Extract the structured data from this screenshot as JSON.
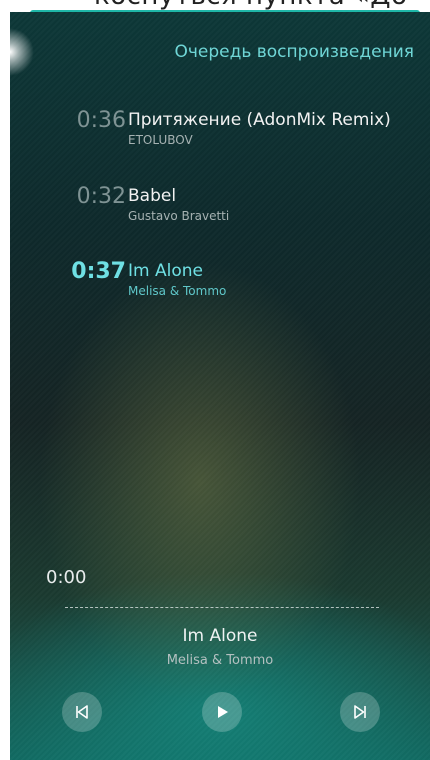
{
  "caption": {
    "text": "коснуться пункта «До"
  },
  "colors": {
    "accent": "#1fb7a8",
    "highlight": "#6fe0e4"
  },
  "queue": {
    "title": "Очередь воспроизведения",
    "tracks": [
      {
        "time": "0:36",
        "title": "Притяжение (AdonMix Remix)",
        "artist": "ETOLUBOV"
      },
      {
        "time": "0:32",
        "title": "Babel",
        "artist": "Gustavo Bravetti"
      },
      {
        "time": "0:37",
        "title": "Im Alone",
        "artist": "Melisa & Tommo"
      }
    ]
  },
  "player": {
    "elapsed": "0:00",
    "title": "Im Alone",
    "artist": "Melisa & Tommo",
    "controls": {
      "prev_icon": "skip-previous-icon",
      "play_icon": "play-icon",
      "next_icon": "skip-next-icon"
    }
  }
}
